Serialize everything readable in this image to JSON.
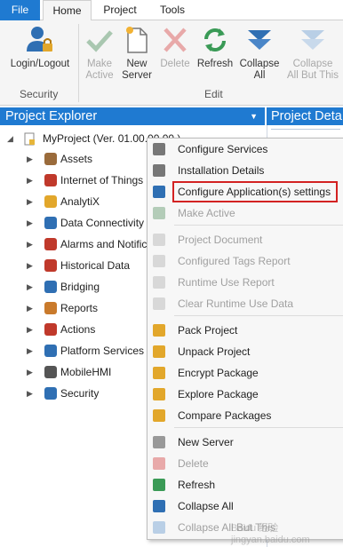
{
  "tabs": {
    "file": "File",
    "home": "Home",
    "project": "Project",
    "tools": "Tools"
  },
  "ribbon": {
    "login": "Login/Logout",
    "make_active": [
      "Make",
      "Active"
    ],
    "new_server": [
      "New",
      "Server"
    ],
    "delete": "Delete",
    "refresh": "Refresh",
    "collapse_all": [
      "Collapse",
      "All"
    ],
    "collapse_all_but_this": [
      "Collapse",
      "All But This"
    ],
    "group_security": "Security",
    "group_edit": "Edit"
  },
  "explorer": {
    "title": "Project Explorer",
    "details_title": "Project Deta"
  },
  "tree": {
    "root": "MyProject (Ver. 01.00.00.00 )",
    "items": [
      "Assets",
      "Internet of Things",
      "AnalytiX",
      "Data Connectivity",
      "Alarms and Notific",
      "Historical Data",
      "Bridging",
      "Reports",
      "Actions",
      "Platform Services",
      "MobileHMI",
      "Security"
    ]
  },
  "menu": {
    "items": [
      "Configure Services",
      "Installation Details",
      "Configure Application(s) settings",
      "Make Active",
      "Project Document",
      "Configured Tags Report",
      "Runtime Use Report",
      "Clear Runtime Use Data",
      "Pack Project",
      "Unpack Project",
      "Encrypt Package",
      "Explore Package",
      "Compare Packages",
      "New Server",
      "Delete",
      "Refresh",
      "Collapse All",
      "Collapse All But This"
    ]
  },
  "colors": {
    "accent": "#1f7ad1",
    "highlight": "#d32222"
  },
  "watermark": "Baidu 经验 jingyan.baidu.com"
}
